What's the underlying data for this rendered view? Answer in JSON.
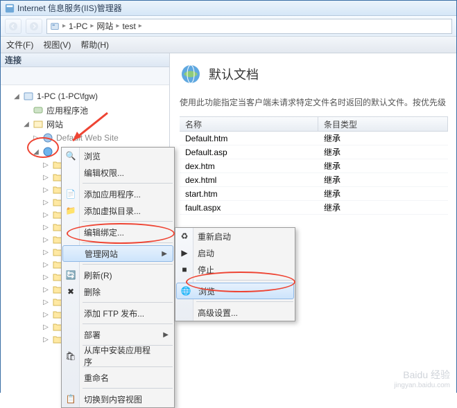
{
  "window": {
    "title": "Internet 信息服务(IIS)管理器"
  },
  "breadcrumb": {
    "root": "1-PC",
    "level1": "网站",
    "level2": "test"
  },
  "menubar": {
    "file": "文件(F)",
    "view": "视图(V)",
    "help": "帮助(H)"
  },
  "sidebar": {
    "header": "连接",
    "server": "1-PC (1-PC\\fgw)",
    "app_pool": "应用程序池",
    "sites": "网站",
    "default_site": "Default Web Site"
  },
  "content": {
    "title": "默认文档",
    "desc": "使用此功能指定当客户端未请求特定文件名时返回的默认文件。按优先级",
    "col_name": "名称",
    "col_type": "条目类型",
    "rows": [
      {
        "name": "Default.htm",
        "type": "继承"
      },
      {
        "name": "Default.asp",
        "type": "继承"
      },
      {
        "name": "dex.htm",
        "type": "继承"
      },
      {
        "name": "dex.html",
        "type": "继承"
      },
      {
        "name": "start.htm",
        "type": "继承"
      },
      {
        "name": "fault.aspx",
        "type": "继承"
      }
    ]
  },
  "ctx1": {
    "explore": "浏览",
    "edit_perm": "编辑权限...",
    "add_app": "添加应用程序...",
    "add_vdir": "添加虚拟目录...",
    "edit_bind": "编辑绑定...",
    "manage_site": "管理网站",
    "refresh": "刷新(R)",
    "delete": "删除",
    "add_ftp": "添加 FTP 发布...",
    "deploy": "部署",
    "install_from_lib": "从库中安装应用程序",
    "rename": "重命名",
    "switch_view": "切换到内容视图"
  },
  "ctx2": {
    "restart": "重新启动",
    "start": "启动",
    "stop": "停止",
    "browse": "浏览",
    "advanced": "高级设置..."
  },
  "watermark": {
    "line1": "Baidu 经验",
    "line2": "jingyan.baidu.com"
  }
}
